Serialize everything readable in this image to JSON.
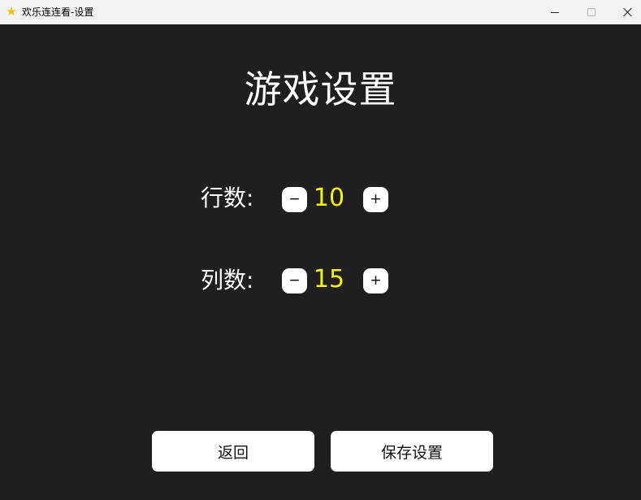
{
  "window": {
    "title": "欢乐连连看-设置",
    "app_icon": "★",
    "controls": {
      "minimize": "minimize-icon",
      "maximize": "maximize-icon",
      "close": "close-icon"
    }
  },
  "settings": {
    "title": "游戏设置",
    "rows": {
      "label": "行数:",
      "value": "10",
      "decrement": "−",
      "increment": "+"
    },
    "cols": {
      "label": "列数:",
      "value": "15",
      "decrement": "−",
      "increment": "+"
    }
  },
  "buttons": {
    "back": "返回",
    "save": "保存设置"
  },
  "colors": {
    "background": "#1f1f1f",
    "value_text": "#f5f500",
    "titlebar": "#f3f3f3"
  }
}
